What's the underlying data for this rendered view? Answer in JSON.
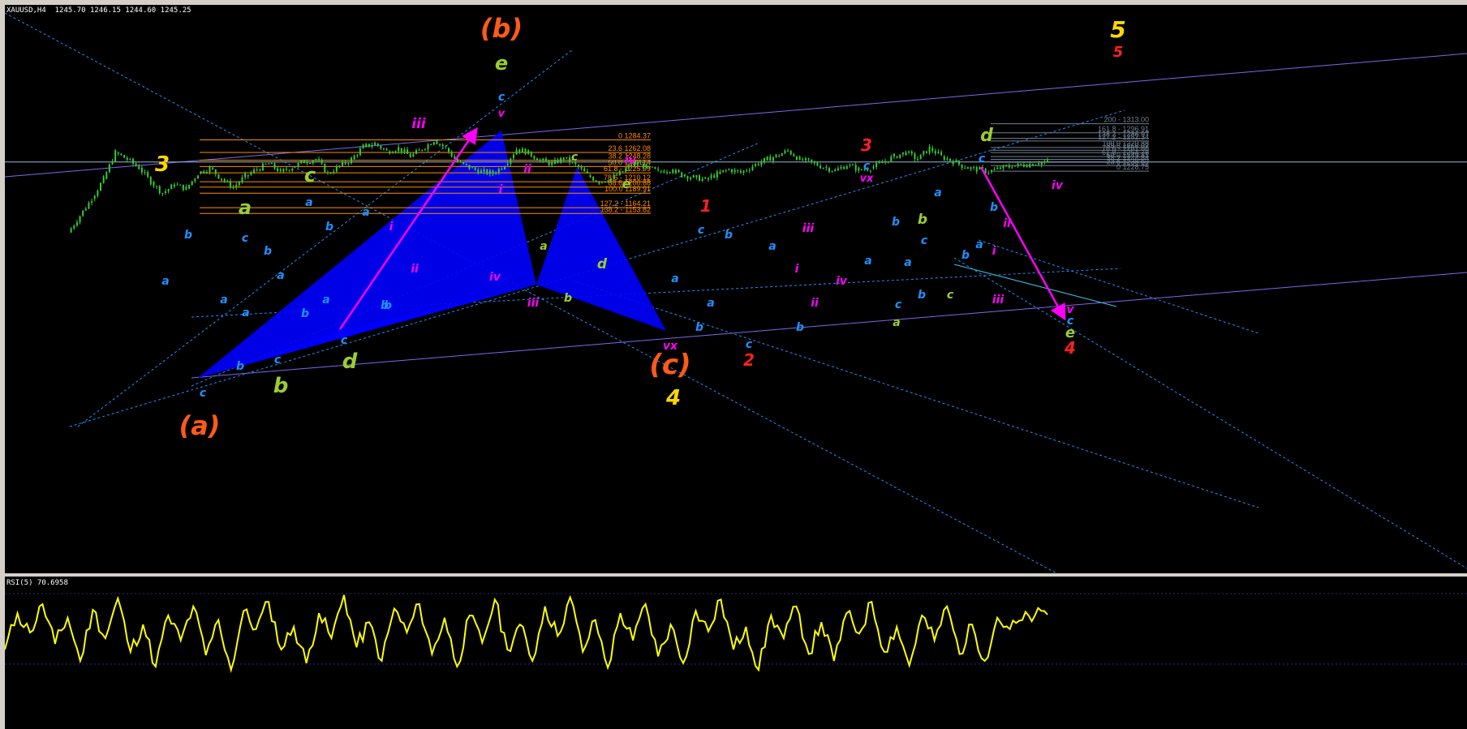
{
  "symbol_header": "XAUUSD,H4  1245.70 1246.15 1244.60 1245.25",
  "rsi_header": "RSI(5) 70.6958",
  "fib_left": [
    {
      "label": "0 1284.37",
      "price": 1284.37
    },
    {
      "label": "23.6 1262.08",
      "price": 1262.08
    },
    {
      "label": "38.2 1248.28",
      "price": 1248.28
    },
    {
      "label": "50.0 1237.14",
      "price": 1237.14
    },
    {
      "label": "61.8 - 1225.99",
      "price": 1225.99
    },
    {
      "label": "78.6 - 1210.12",
      "price": 1210.12
    },
    {
      "label": "88.6 1200.68",
      "price": 1200.68
    },
    {
      "label": "100.0 1189.91",
      "price": 1189.91
    },
    {
      "label": "127.2 - 1164.21",
      "price": 1164.21
    },
    {
      "label": "138.2 - 1153.82",
      "price": 1153.82
    }
  ],
  "fib_right": [
    {
      "label": "200 - 1313.00",
      "price": 1313.0
    },
    {
      "label": "161.8 - 1296.91",
      "price": 1296.91
    },
    {
      "label": "138.2 - 1286.97",
      "price": 1286.97
    },
    {
      "label": "127.2 - 1282.34",
      "price": 1282.34
    },
    {
      "label": "100.0 1270.88",
      "price": 1270.88
    },
    {
      "label": "88.6 1266.07",
      "price": 1266.07
    },
    {
      "label": "78.6 - 1261.86",
      "price": 1261.86
    },
    {
      "label": "61.8 - 1254.78",
      "price": 1254.78
    },
    {
      "label": "50.0 1249.81",
      "price": 1249.81
    },
    {
      "label": "38.2 1244.84",
      "price": 1244.84
    },
    {
      "label": "23.6 1238.69",
      "price": 1238.69
    },
    {
      "label": "0 1228.75",
      "price": 1228.75
    }
  ],
  "wave_labels": [
    {
      "t": "(b)",
      "c": "#ff5a1a"
    },
    {
      "t": "e",
      "c": "#9acd32"
    },
    {
      "t": "c",
      "c": "#1e90ff"
    },
    {
      "t": "v",
      "c": "#ff00ff"
    },
    {
      "t": "iii",
      "c": "#ff00ff"
    },
    {
      "t": "3",
      "c": "#ffd700"
    },
    {
      "t": "c",
      "c": "#9acd32"
    },
    {
      "t": "a",
      "c": "#9acd32"
    },
    {
      "t": "a",
      "c": "#1e90ff"
    },
    {
      "t": "b",
      "c": "#1e90ff"
    },
    {
      "t": "a",
      "c": "#1e90ff"
    },
    {
      "t": "c",
      "c": "#1e90ff"
    },
    {
      "t": "b",
      "c": "#1e90ff"
    },
    {
      "t": "a",
      "c": "#1e90ff"
    },
    {
      "t": "a",
      "c": "#1e90ff"
    },
    {
      "t": "a",
      "c": "#1e90ff"
    },
    {
      "t": "b",
      "c": "#1e90ff"
    },
    {
      "t": "a",
      "c": "#1e90ff"
    },
    {
      "t": "b",
      "c": "#1e90ff"
    },
    {
      "t": "c",
      "c": "#1e90ff"
    },
    {
      "t": "b",
      "c": "#1e90ff"
    },
    {
      "t": "b",
      "c": "#1e90ff"
    },
    {
      "t": "c",
      "c": "#1e90ff"
    },
    {
      "t": "b",
      "c": "#9acd32"
    },
    {
      "t": "d",
      "c": "#9acd32"
    },
    {
      "t": "c",
      "c": "#1e90ff"
    },
    {
      "t": "(a)",
      "c": "#ff5a1a"
    },
    {
      "t": "a",
      "c": "#1e90ff"
    },
    {
      "t": "i",
      "c": "#ff00ff"
    },
    {
      "t": "ii",
      "c": "#ff00ff"
    },
    {
      "t": "b",
      "c": "#1e90ff"
    },
    {
      "t": "ii",
      "c": "#ff00ff"
    },
    {
      "t": "i",
      "c": "#ff00ff"
    },
    {
      "t": "iv",
      "c": "#ff00ff"
    },
    {
      "t": "iii",
      "c": "#ff00ff"
    },
    {
      "t": "c",
      "c": "#9acd32"
    },
    {
      "t": "iv",
      "c": "#ff00ff"
    },
    {
      "t": "e",
      "c": "#9acd32"
    },
    {
      "t": "a",
      "c": "#9acd32"
    },
    {
      "t": "b",
      "c": "#9acd32"
    },
    {
      "t": "d",
      "c": "#9acd32"
    },
    {
      "t": "vx",
      "c": "#ff00ff"
    },
    {
      "t": "(c)",
      "c": "#ff5a1a"
    },
    {
      "t": "4",
      "c": "#ffd700"
    },
    {
      "t": "1",
      "c": "#ff2020"
    },
    {
      "t": "c",
      "c": "#1e90ff"
    },
    {
      "t": "b",
      "c": "#1e90ff"
    },
    {
      "t": "a",
      "c": "#1e90ff"
    },
    {
      "t": "a",
      "c": "#1e90ff"
    },
    {
      "t": "b",
      "c": "#1e90ff"
    },
    {
      "t": "c",
      "c": "#1e90ff"
    },
    {
      "t": "2",
      "c": "#ff2020"
    },
    {
      "t": "a",
      "c": "#1e90ff"
    },
    {
      "t": "iii",
      "c": "#ff00ff"
    },
    {
      "t": "i",
      "c": "#ff00ff"
    },
    {
      "t": "ii",
      "c": "#ff00ff"
    },
    {
      "t": "b",
      "c": "#1e90ff"
    },
    {
      "t": "iv",
      "c": "#ff00ff"
    },
    {
      "t": "3",
      "c": "#ff2020"
    },
    {
      "t": "c",
      "c": "#1e90ff"
    },
    {
      "t": "vx",
      "c": "#ff00ff"
    },
    {
      "t": "b",
      "c": "#1e90ff"
    },
    {
      "t": "a",
      "c": "#1e90ff"
    },
    {
      "t": "b",
      "c": "#9acd32"
    },
    {
      "t": "c",
      "c": "#1e90ff"
    },
    {
      "t": "a",
      "c": "#1e90ff"
    },
    {
      "t": "b",
      "c": "#1e90ff"
    },
    {
      "t": "c",
      "c": "#1e90ff"
    },
    {
      "t": "a",
      "c": "#9acd32"
    },
    {
      "t": "a",
      "c": "#1e90ff"
    },
    {
      "t": "c",
      "c": "#9acd32"
    },
    {
      "t": "d",
      "c": "#9acd32"
    },
    {
      "t": "c",
      "c": "#1e90ff"
    },
    {
      "t": "b",
      "c": "#1e90ff"
    },
    {
      "t": "iv",
      "c": "#ff00ff"
    },
    {
      "t": "ii",
      "c": "#ff00ff"
    },
    {
      "t": "a",
      "c": "#1e90ff"
    },
    {
      "t": "b",
      "c": "#1e90ff"
    },
    {
      "t": "i",
      "c": "#ff00ff"
    },
    {
      "t": "iii",
      "c": "#ff00ff"
    },
    {
      "t": "v",
      "c": "#ff00ff"
    },
    {
      "t": "c",
      "c": "#1e90ff"
    },
    {
      "t": "e",
      "c": "#9acd32"
    },
    {
      "t": "4",
      "c": "#ff2020"
    },
    {
      "t": "5",
      "c": "#ffd700"
    },
    {
      "t": "5",
      "c": "#ff2020"
    }
  ],
  "colors": {
    "background": "#000000",
    "candles": "#32cd32",
    "fib_left": "#ff8c00",
    "fib_right": "#708090",
    "channel_lines": "#7b68ee",
    "dashed_lines": "#1e90ff",
    "harmonic_fill": "#0000ff",
    "rsi_line": "#ffff00",
    "arrows": "#ff00ff",
    "current_price_line": "#8fbcd8"
  },
  "chart_data": [
    {
      "type": "line",
      "title": "XAUUSD,H4",
      "ohlc_last": {
        "open": 1245.7,
        "high": 1246.15,
        "low": 1244.6,
        "close": 1245.25
      },
      "x": [
        0,
        4,
        8,
        12,
        16,
        20,
        24,
        28,
        32,
        36,
        40,
        44,
        48,
        52,
        56,
        60,
        64,
        68,
        72,
        76,
        80,
        84,
        88,
        92,
        96,
        100,
        104,
        108,
        112,
        116,
        120,
        124,
        128,
        132,
        136,
        140,
        144,
        148,
        152,
        156,
        160,
        164,
        168,
        172,
        176,
        180,
        184,
        188,
        192,
        196,
        200,
        204,
        208,
        212,
        216,
        220,
        224,
        228,
        232,
        236,
        240,
        244,
        248,
        252,
        256,
        260,
        264,
        268,
        272,
        276,
        280,
        284,
        288,
        292,
        296,
        300,
        304,
        308,
        312,
        316,
        320,
        324,
        328,
        332
      ],
      "values": [
        1120,
        1150,
        1180,
        1215,
        1262,
        1250,
        1235,
        1210,
        1190,
        1205,
        1198,
        1225,
        1235,
        1215,
        1200,
        1220,
        1232,
        1242,
        1228,
        1236,
        1246,
        1250,
        1225,
        1238,
        1250,
        1272,
        1278,
        1264,
        1270,
        1255,
        1268,
        1284,
        1270,
        1245,
        1235,
        1228,
        1225,
        1240,
        1268,
        1262,
        1248,
        1242,
        1252,
        1240,
        1222,
        1210,
        1216,
        1228,
        1244,
        1236,
        1228,
        1232,
        1222,
        1218,
        1214,
        1224,
        1232,
        1226,
        1238,
        1248,
        1256,
        1265,
        1250,
        1244,
        1236,
        1230,
        1240,
        1232,
        1234,
        1244,
        1255,
        1262,
        1250,
        1270,
        1255,
        1246,
        1236,
        1232,
        1228,
        1234,
        1238,
        1240,
        1243,
        1245
      ],
      "ylim": [
        1140,
        1320
      ]
    },
    {
      "type": "line",
      "title": "RSI(5)",
      "current": 70.6958,
      "values": [
        40,
        72,
        55,
        80,
        45,
        68,
        30,
        75,
        50,
        85,
        38,
        62,
        25,
        70,
        48,
        78,
        35,
        66,
        22,
        74,
        58,
        82,
        40,
        60,
        28,
        72,
        50,
        88,
        42,
        64,
        30,
        76,
        55,
        80,
        36,
        68,
        25,
        70,
        46,
        84,
        40,
        62,
        30,
        78,
        52,
        86,
        38,
        66,
        24,
        72,
        48,
        80,
        34,
        62,
        28,
        74,
        56,
        84,
        40,
        60,
        22,
        70,
        50,
        78,
        36,
        64,
        30,
        72,
        54,
        82,
        38,
        60,
        26,
        70,
        48,
        78,
        36,
        62,
        30,
        68,
        58,
        66,
        70,
        70.7
      ],
      "ylim": [
        0,
        100
      ]
    }
  ]
}
